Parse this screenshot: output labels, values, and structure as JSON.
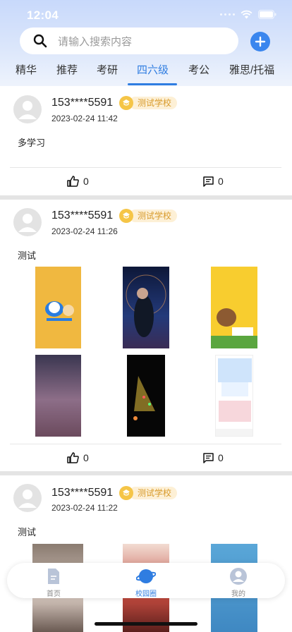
{
  "status_bar": {
    "time": "12:04"
  },
  "search": {
    "placeholder": "请输入搜索内容"
  },
  "tabs": [
    {
      "label": "精华"
    },
    {
      "label": "推荐"
    },
    {
      "label": "考研"
    },
    {
      "label": "四六级",
      "active": true
    },
    {
      "label": "考公"
    },
    {
      "label": "雅思/托福"
    }
  ],
  "posts": [
    {
      "author": "153****5591",
      "school": "测试学校",
      "time": "2023-02-24 11:42",
      "content": "多学习",
      "likes": "0",
      "comments": "0"
    },
    {
      "author": "153****5591",
      "school": "测试学校",
      "time": "2023-02-24 11:26",
      "content": "测试",
      "likes": "0",
      "comments": "0"
    },
    {
      "author": "153****5591",
      "school": "测试学校",
      "time": "2023-02-24 11:22",
      "content": "测试"
    }
  ],
  "bottom_nav": [
    {
      "label": "首页",
      "icon": "document-icon"
    },
    {
      "label": "校园圈",
      "icon": "planet-icon",
      "active": true
    },
    {
      "label": "我的",
      "icon": "profile-icon"
    }
  ],
  "colors": {
    "accent": "#2f7de1",
    "badge_bg": "#fdf0d6",
    "badge_text": "#d89a2a"
  }
}
